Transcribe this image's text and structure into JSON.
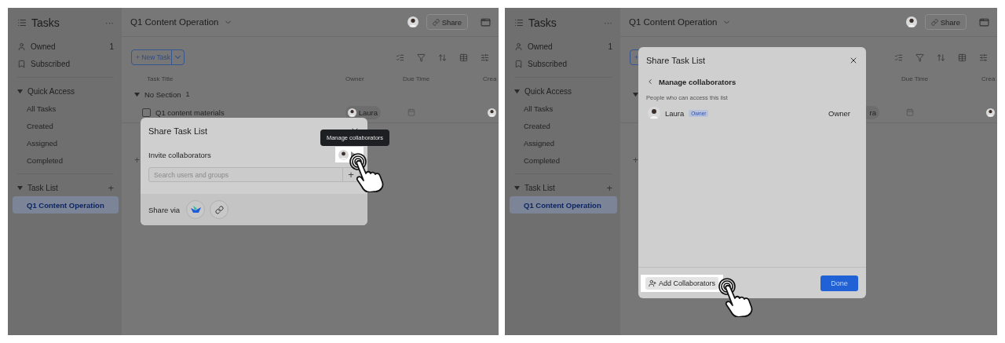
{
  "panels": [
    {
      "sidebar": {
        "title": "Tasks",
        "more": "···",
        "top": [
          {
            "label": "Owned",
            "count": "1"
          },
          {
            "label": "Subscribed"
          }
        ],
        "groups": [
          {
            "label": "Quick Access",
            "expanded": true,
            "children": [
              {
                "label": "All Tasks",
                "selected": false
              },
              {
                "label": "Created",
                "selected": false
              },
              {
                "label": "Assigned",
                "selected": false
              },
              {
                "label": "Completed",
                "selected": false
              }
            ]
          },
          {
            "label": "Task List",
            "expanded": true,
            "add": "+",
            "children": [
              {
                "label": "Q1 Content Operation",
                "selected": true
              }
            ]
          }
        ]
      },
      "main": {
        "title": "Q1 Content Operation",
        "share": "Share",
        "new_task": "+ New Task",
        "columns": [
          "Task Title",
          "Owner",
          "Due Time",
          "Crea"
        ],
        "section": {
          "label": "No Section",
          "count": "1",
          "expanded": true
        },
        "rows": [
          {
            "title": "Q1 content materials",
            "checked": false,
            "owner": "Laura"
          }
        ],
        "add": "+"
      },
      "dialog": {
        "kind": "invite",
        "title": "Share Task List",
        "subtitle": "Invite collaborators",
        "placeholder": "Search users and groups",
        "add": "+",
        "share_via": "Share via"
      },
      "tooltip": {
        "text": "Manage collaborators"
      }
    },
    {
      "sidebar": {
        "title": "Tasks",
        "more": "···",
        "top": [
          {
            "label": "Owned",
            "count": "1"
          },
          {
            "label": "Subscribed"
          }
        ],
        "groups": [
          {
            "label": "Quick Access",
            "expanded": true,
            "children": [
              {
                "label": "All Tasks",
                "selected": false
              },
              {
                "label": "Created",
                "selected": false
              },
              {
                "label": "Assigned",
                "selected": false
              },
              {
                "label": "Completed",
                "selected": false
              }
            ]
          },
          {
            "label": "Task List",
            "expanded": true,
            "add": "+",
            "children": [
              {
                "label": "Q1 Content Operation",
                "selected": true
              }
            ]
          }
        ]
      },
      "main": {
        "title": "Q1 Content Operation",
        "share": "Share",
        "new_task": "+",
        "columns": [
          "Due Time",
          "Crea"
        ],
        "section": {
          "expanded": true
        },
        "rows": [
          {
            "owner": "ra"
          }
        ],
        "add": "+"
      },
      "dialog": {
        "kind": "manage",
        "title": "Share Task List",
        "back": "Manage collaborators",
        "caption": "People who can access this list",
        "people": [
          {
            "name": "Laura",
            "tag": "Owner",
            "role": "Owner"
          }
        ],
        "add_button": "Add Collaborators",
        "done": "Done"
      }
    }
  ]
}
